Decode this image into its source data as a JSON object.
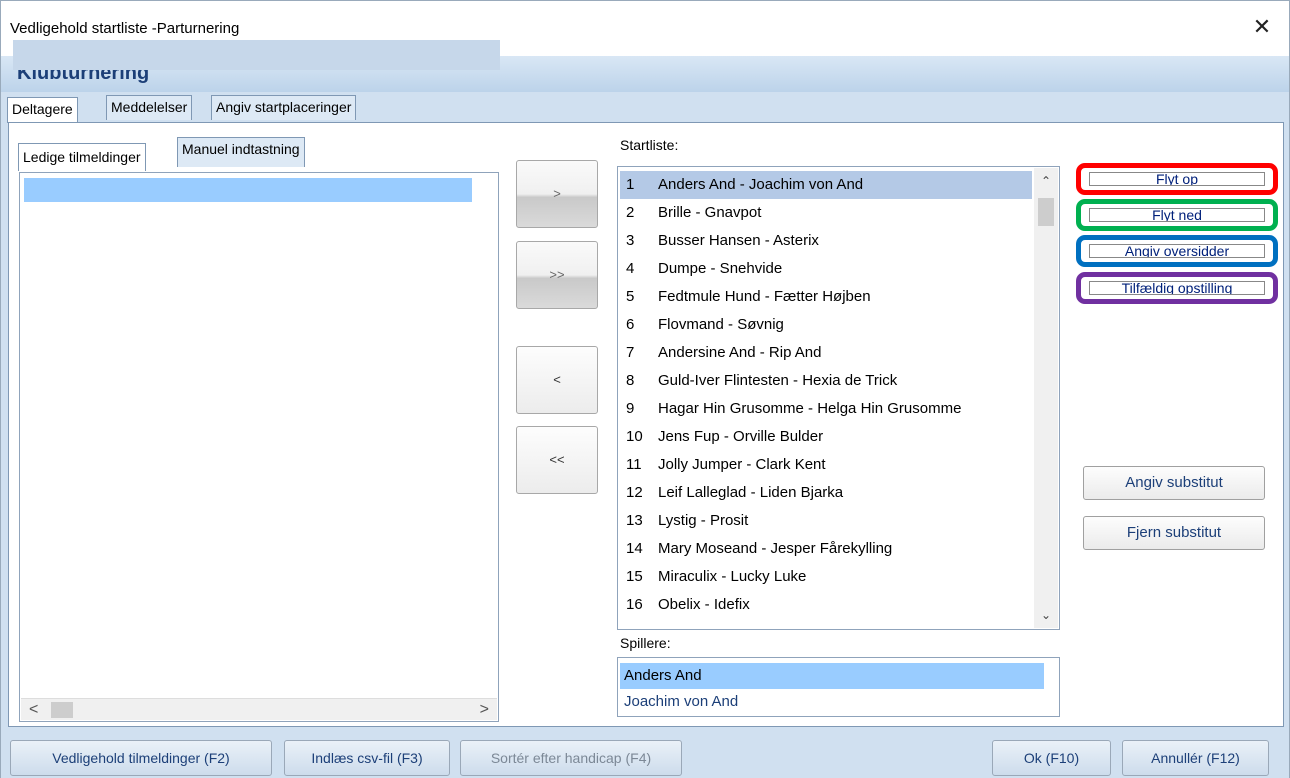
{
  "window": {
    "title": "Vedligehold startliste -Parturnering",
    "close_glyph": "✕"
  },
  "header": {
    "title": "Klubturnering"
  },
  "tabs": [
    {
      "label": "Deltagere",
      "active": true
    },
    {
      "label": "Meddelelser",
      "active": false
    },
    {
      "label": "Angiv startplaceringer",
      "active": false
    }
  ],
  "left_panel": {
    "subtabs": [
      {
        "label": "Ledige tilmeldinger",
        "active": true
      },
      {
        "label": "Manuel indtastning",
        "active": false
      }
    ],
    "scroll_left": "<",
    "scroll_right": ">"
  },
  "move_buttons": {
    "add": ">",
    "add_all": ">>",
    "remove": "<",
    "remove_all": "<<"
  },
  "startlist": {
    "label": "Startliste:",
    "selected_index": 0,
    "rows": [
      {
        "num": "1",
        "text": "Anders And - Joachim von And"
      },
      {
        "num": "2",
        "text": "Brille - Gnavpot"
      },
      {
        "num": "3",
        "text": "Busser Hansen - Asterix"
      },
      {
        "num": "4",
        "text": "Dumpe - Snehvide"
      },
      {
        "num": "5",
        "text": "Fedtmule Hund - Fætter Højben"
      },
      {
        "num": "6",
        "text": "Flovmand - Søvnig"
      },
      {
        "num": "7",
        "text": "Andersine And - Rip And"
      },
      {
        "num": "8",
        "text": "Guld-Iver Flintesten - Hexia de Trick"
      },
      {
        "num": "9",
        "text": "Hagar Hin Grusomme - Helga Hin Grusomme"
      },
      {
        "num": "10",
        "text": "Jens Fup - Orville Bulder"
      },
      {
        "num": "11",
        "text": "Jolly Jumper - Clark Kent"
      },
      {
        "num": "12",
        "text": "Leif Lalleglad - Liden Bjarka"
      },
      {
        "num": "13",
        "text": "Lystig - Prosit"
      },
      {
        "num": "14",
        "text": "Mary Moseand - Jesper Fårekylling"
      },
      {
        "num": "15",
        "text": "Miraculix - Lucky Luke"
      },
      {
        "num": "16",
        "text": "Obelix - Idefix"
      }
    ]
  },
  "players": {
    "label": "Spillere:",
    "rows": [
      "Anders And",
      "Joachim von And"
    ]
  },
  "action_buttons": [
    {
      "label": "Flyt op",
      "color": "#ff0000"
    },
    {
      "label": "Flyt ned",
      "color": "#00b050"
    },
    {
      "label": "Angiv oversidder",
      "color": "#0070c0"
    },
    {
      "label": "Tilfældig opstilling",
      "color": "#7030a0"
    }
  ],
  "substitute_buttons": {
    "set": "Angiv substitut",
    "remove": "Fjern substitut"
  },
  "footer": {
    "maintain": "Vedligehold tilmeldinger (F2)",
    "import_csv": "Indlæs csv-fil (F3)",
    "sort_handicap": "Sortér efter handicap (F4)",
    "ok": "Ok (F10)",
    "cancel": "Annullér (F12)"
  }
}
